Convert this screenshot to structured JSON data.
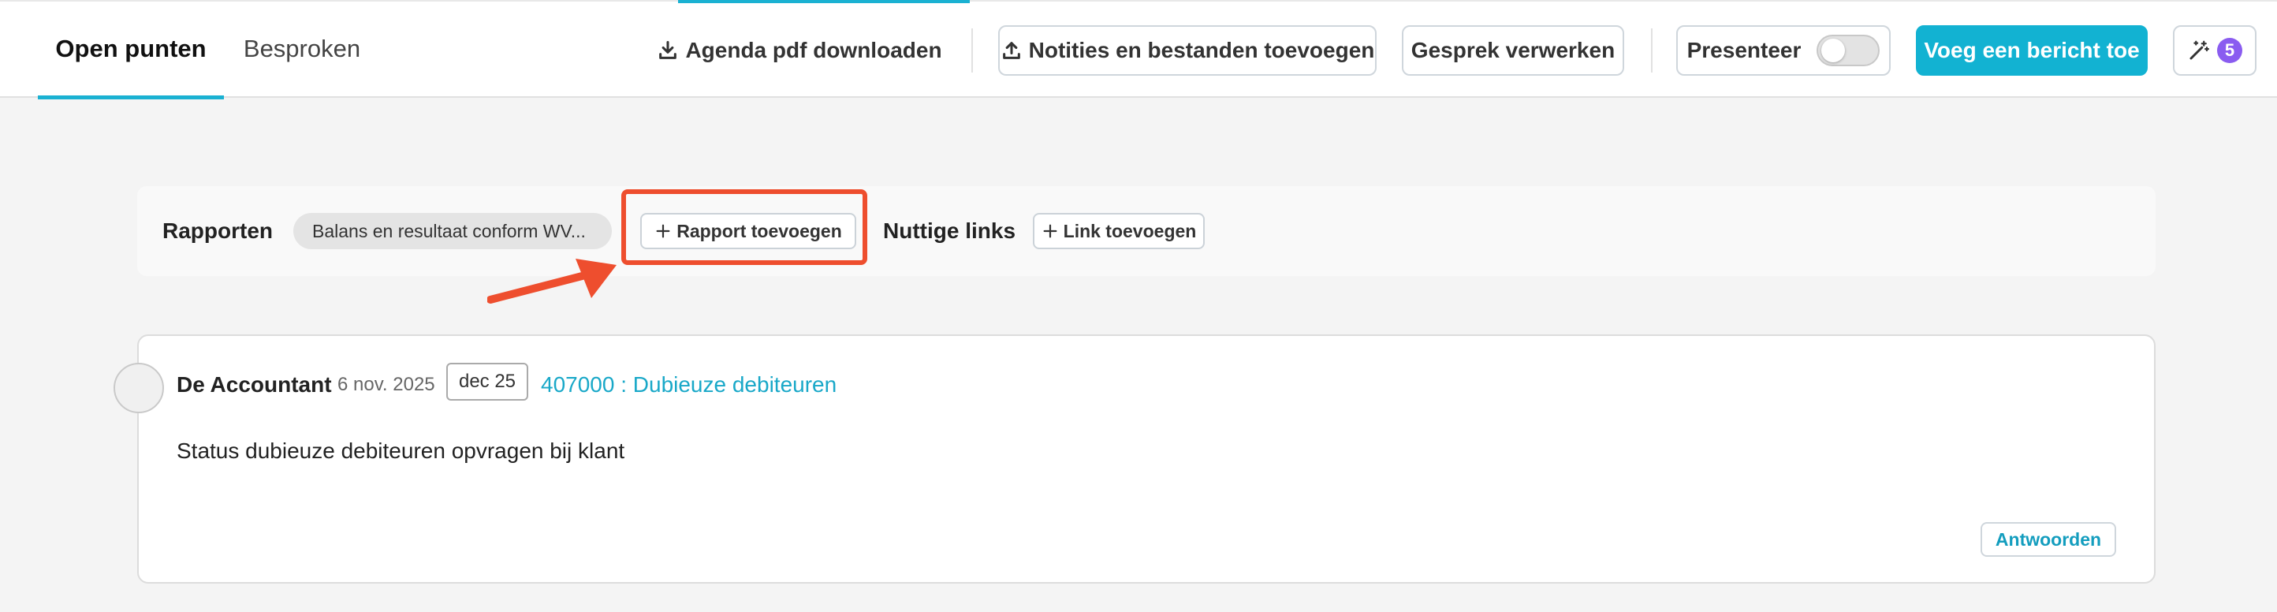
{
  "tabs": {
    "open": "Open punten",
    "besproken": "Besproken"
  },
  "toolbar": {
    "download_agenda": "Agenda pdf downloaden",
    "add_notes_files": "Notities en bestanden toevoegen",
    "process_meeting": "Gesprek verwerken",
    "present": "Presenteer",
    "add_message": "Voeg een bericht toe",
    "ai_count": "5"
  },
  "reports": {
    "label": "Rapporten",
    "chip": "Balans en resultaat conform WV...",
    "add_report": "Rapport toevoegen",
    "links_label": "Nuttige links",
    "add_link": "Link toevoegen"
  },
  "message": {
    "author": "De Accountant",
    "date": "6 nov. 2025",
    "period": "dec 25",
    "account": "407000 : Dubieuze debiteuren",
    "body": "Status dubieuze debiteuren opvragen bij klant",
    "reply": "Antwoorden"
  },
  "colors": {
    "accent": "#12b2d2",
    "highlight": "#ee4e2e",
    "badge": "#8a5cf0"
  },
  "icons": {
    "download": "download-icon",
    "upload": "upload-icon",
    "plus": "plus-icon",
    "magic": "magic-wand-icon",
    "arrow": "annotation-arrow"
  }
}
